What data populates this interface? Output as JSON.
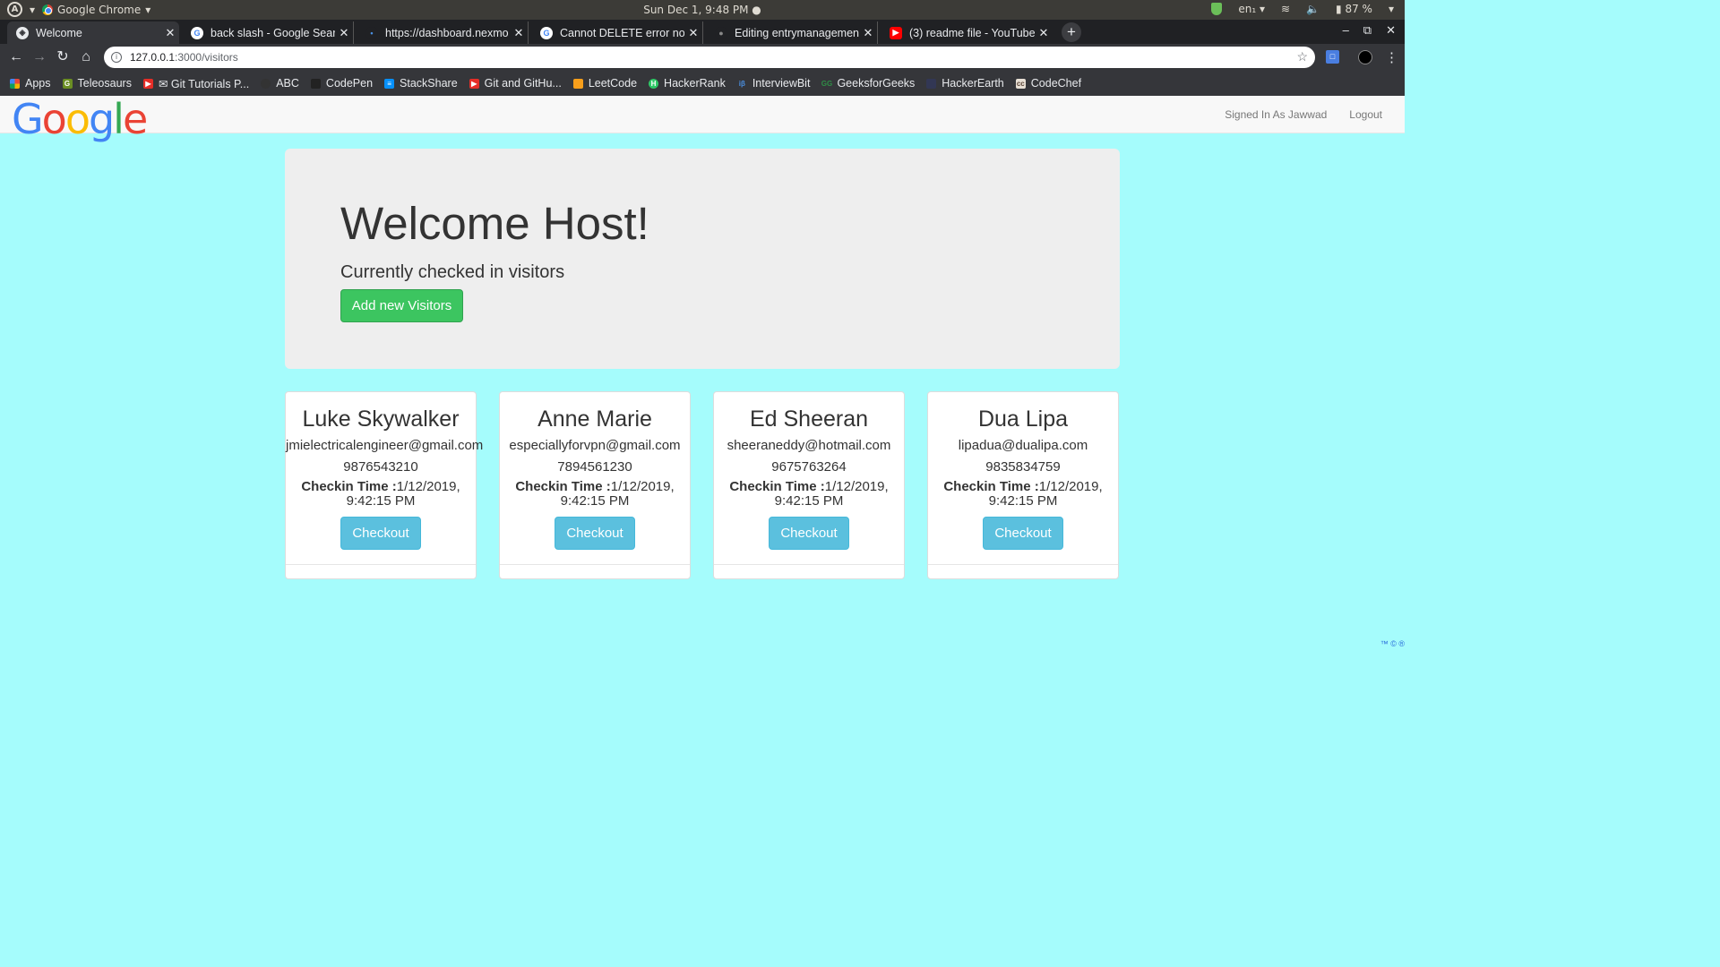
{
  "os": {
    "app_name": "Google Chrome",
    "clock": "Sun Dec  1,  9:48 PM ●",
    "lang": "en₁ ▾",
    "battery": "87 %"
  },
  "browser": {
    "tabs": [
      {
        "title": "Welcome",
        "active": true
      },
      {
        "title": "back slash - Google Search"
      },
      {
        "title": "https://dashboard.nexmo"
      },
      {
        "title": "Cannot DELETE error nod"
      },
      {
        "title": "Editing entrymanagemen"
      },
      {
        "title": "(3) readme file - YouTube"
      }
    ],
    "url_host": "127.0.0.1",
    "url_path": ":3000/visitors",
    "bookmarks": [
      {
        "label": "Apps",
        "color": "#e8453c"
      },
      {
        "label": "Teleosaurs",
        "color": "#6b8e23"
      },
      {
        "label": "✉ Git Tutorials P...",
        "color": "#e52d27"
      },
      {
        "label": "ABC",
        "color": "#333333"
      },
      {
        "label": "CodePen",
        "color": "#222222"
      },
      {
        "label": "StackShare",
        "color": "#0690fa"
      },
      {
        "label": "Git and GitHu...",
        "color": "#e52d27"
      },
      {
        "label": "LeetCode",
        "color": "#f89f1b"
      },
      {
        "label": "HackerRank",
        "color": "#2ec866"
      },
      {
        "label": "InterviewBit",
        "color": "#4a90e2"
      },
      {
        "label": "GeeksforGeeks",
        "color": "#2f8d46"
      },
      {
        "label": "HackerEarth",
        "color": "#323754"
      },
      {
        "label": "CodeChef",
        "color": "#5b4638"
      }
    ]
  },
  "page": {
    "logo": "Google",
    "nav_user": "Signed In As Jawwad",
    "nav_logout": "Logout",
    "jumbotron": {
      "heading": "Welcome Host!",
      "subheading": "Currently checked in visitors",
      "add_button": "Add new Visitors"
    },
    "checkin_label": "Checkin Time :",
    "checkout_label": "Checkout",
    "visitors": [
      {
        "name": "Luke Skywalker",
        "email": "jmielectricalengineer@gmail.com",
        "phone": "9876543210",
        "checkin": "1/12/2019, 9:42:15 PM"
      },
      {
        "name": "Anne Marie",
        "email": "especiallyforvpn@gmail.com",
        "phone": "7894561230",
        "checkin": "1/12/2019, 9:42:15 PM"
      },
      {
        "name": "Ed Sheeran",
        "email": "sheeraneddy@hotmail.com",
        "phone": "9675763264",
        "checkin": "1/12/2019, 9:42:15 PM"
      },
      {
        "name": "Dua Lipa",
        "email": "lipadua@dualipa.com",
        "phone": "9835834759",
        "checkin": "1/12/2019, 9:42:15 PM"
      }
    ],
    "footer_marks": "™ © ®"
  },
  "colors": {
    "page_bg": "#a5fcfc",
    "add_button": "#3cc560",
    "checkout_button": "#5bc0de",
    "logo_blue": "#4285f4",
    "logo_red": "#ea4335",
    "logo_yellow": "#fbbc05",
    "logo_green": "#34a853"
  }
}
